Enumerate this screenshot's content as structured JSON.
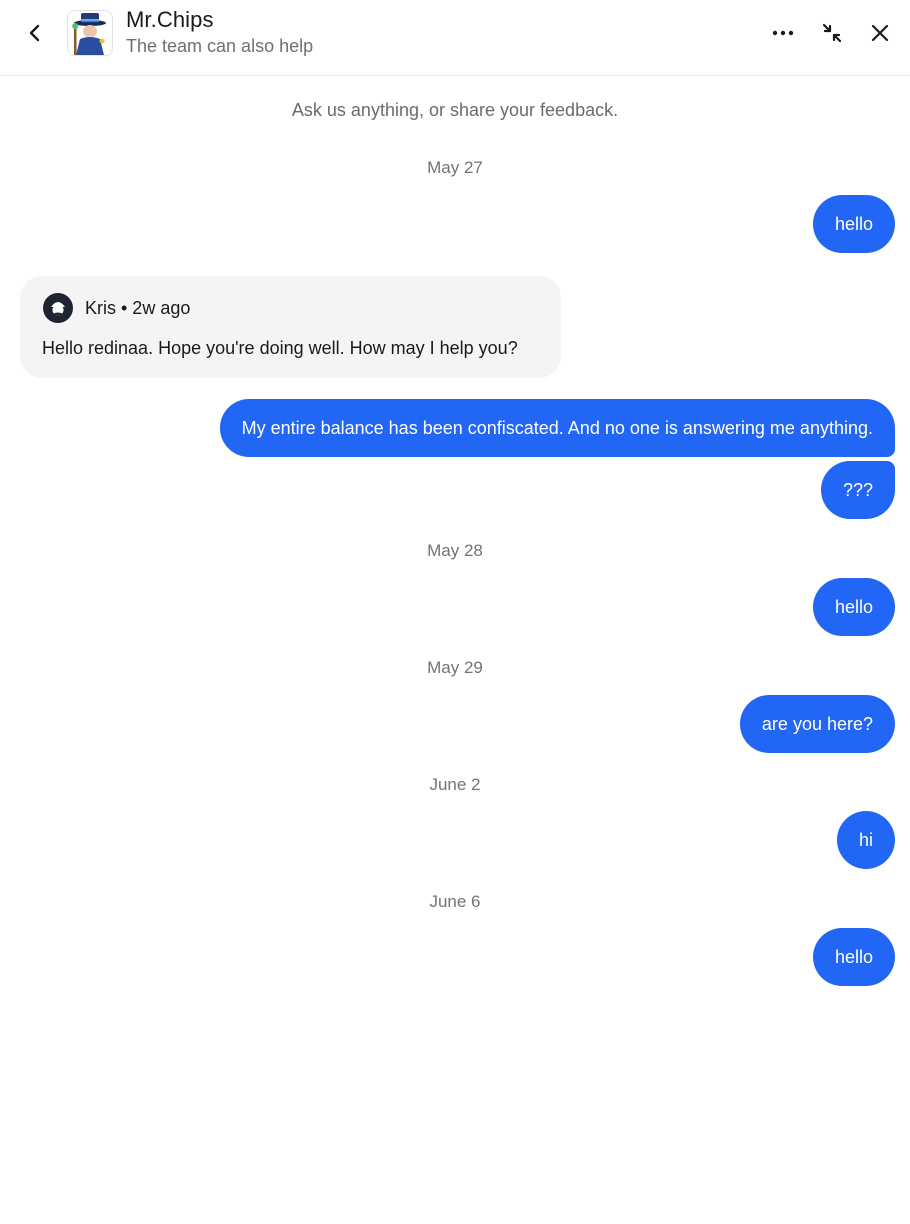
{
  "header": {
    "title": "Mr.Chips",
    "subtitle": "The team can also help",
    "avatar_icon": "wizard-mascot-avatar",
    "icons": [
      "back-chevron-icon",
      "more-dots-icon",
      "collapse-arrows-icon",
      "close-icon"
    ]
  },
  "intro": "Ask us anything, or share your feedback.",
  "dates": {
    "d1": "May 27",
    "d2": "May 28",
    "d3": "May 29",
    "d4": "June 2",
    "d5": "June 6"
  },
  "messages": {
    "m1": "hello",
    "agent": {
      "name_time": "Kris • 2w ago",
      "text": "Hello redinaa. Hope you're doing well. How may I help you?"
    },
    "m2": "My entire balance has been confiscated. And no one is answering me anything.",
    "m3": "???",
    "m4": "hello",
    "m5": "are you here?",
    "m6": "hi",
    "m7": "hello"
  },
  "colors": {
    "outgoing_bubble": "#2266f5",
    "incoming_bubble": "#f4f4f4",
    "muted_text": "#737373"
  }
}
